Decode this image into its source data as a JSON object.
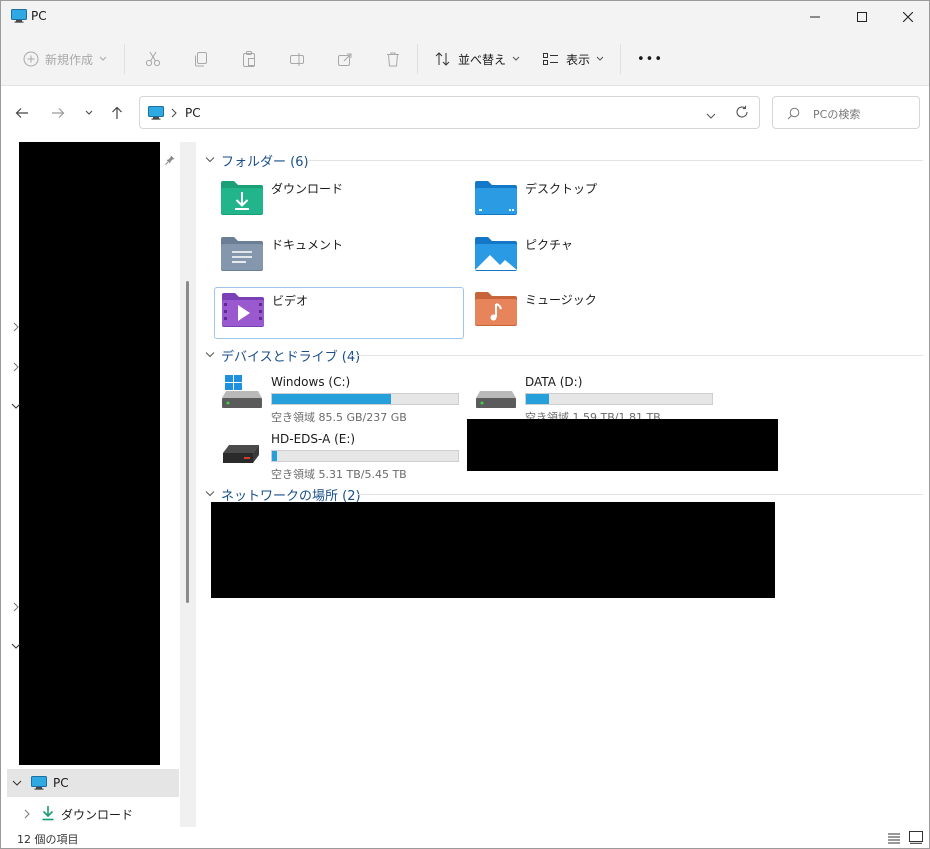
{
  "window": {
    "title": "PC",
    "controls": [
      "minimize",
      "maximize",
      "close"
    ]
  },
  "toolbar": {
    "new_label": "新規作成",
    "sort_label": "並べ替え",
    "view_label": "表示",
    "more_label": "•••",
    "icons": [
      "cut-icon",
      "copy-icon",
      "paste-icon",
      "rename-icon",
      "share-icon",
      "delete-icon"
    ]
  },
  "address": {
    "path": "PC",
    "search_placeholder": "PCの検索"
  },
  "nav": {
    "pc_label": "PC",
    "downloads_label": "ダウンロード"
  },
  "groups": {
    "folders_header": "フォルダー (6)",
    "devices_header": "デバイスとドライブ (4)",
    "network_header": "ネットワークの場所 (2)"
  },
  "folders": [
    {
      "name": "ダウンロード",
      "icon": "download-folder-icon"
    },
    {
      "name": "デスクトップ",
      "icon": "desktop-folder-icon"
    },
    {
      "name": "ドキュメント",
      "icon": "documents-folder-icon"
    },
    {
      "name": "ピクチャ",
      "icon": "pictures-folder-icon"
    },
    {
      "name": "ビデオ",
      "icon": "videos-folder-icon"
    },
    {
      "name": "ミュージック",
      "icon": "music-folder-icon"
    }
  ],
  "drives": [
    {
      "name": "Windows (C:)",
      "free_text": "空き領域 85.5 GB/237 GB",
      "used_fraction": 0.639
    },
    {
      "name": "DATA (D:)",
      "free_text": "空き領域 1.59 TB/1.81 TB",
      "used_fraction": 0.122
    },
    {
      "name": "HD-EDS-A (E:)",
      "free_text": "空き領域 5.31 TB/5.45 TB",
      "used_fraction": 0.026
    }
  ],
  "status": {
    "item_count": "12 個の項目"
  },
  "colors": {
    "accent": "#26a0da",
    "group_header": "#1a4f8b"
  }
}
